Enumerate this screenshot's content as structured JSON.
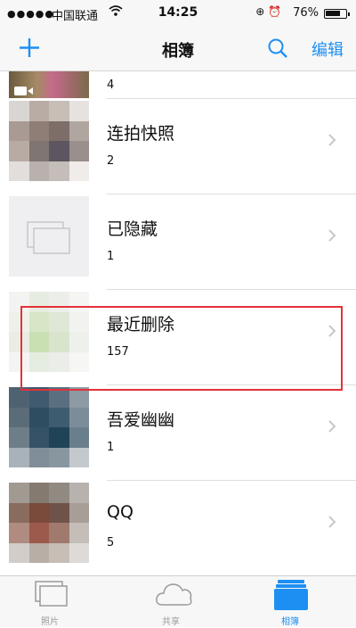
{
  "status_bar": {
    "signal": "●●●●●",
    "carrier": "中国联通",
    "time": "14:25",
    "icons": "⊕ ⏰",
    "battery_percent": "76%",
    "battery_level": 0.76
  },
  "nav": {
    "title": "相簿",
    "edit_label": "编辑",
    "add_icon": "plus-icon",
    "search_icon": "search-icon"
  },
  "albums": [
    {
      "title": "",
      "count": "4"
    },
    {
      "title": "连拍快照",
      "count": "2"
    },
    {
      "title": "已隐藏",
      "count": "1"
    },
    {
      "title": "最近删除",
      "count": "157"
    },
    {
      "title": "吾爱幽幽",
      "count": "1"
    },
    {
      "title": "QQ",
      "count": "5"
    }
  ],
  "tabs": [
    {
      "label": "照片",
      "icon": "photos-icon",
      "active": false
    },
    {
      "label": "共享",
      "icon": "cloud-icon",
      "active": false
    },
    {
      "label": "相簿",
      "icon": "albums-icon",
      "active": true
    }
  ],
  "colors": {
    "accent": "#1d8ff2",
    "highlight": "#e4313a"
  }
}
